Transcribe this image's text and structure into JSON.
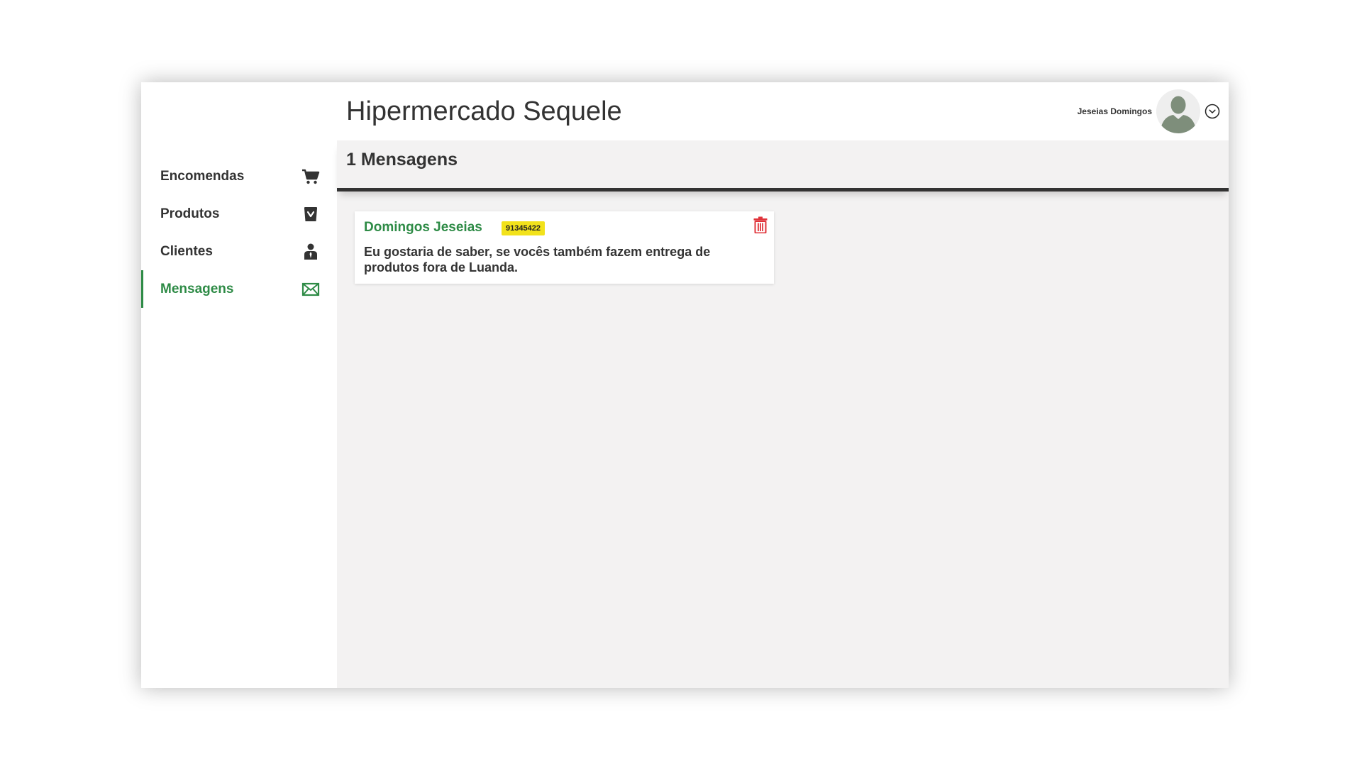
{
  "header": {
    "title": "Hipermercado Sequele",
    "user_name": "Jeseias Domingos"
  },
  "sidebar": {
    "items": [
      {
        "label": "Encomendas",
        "icon": "shopping-cart-icon"
      },
      {
        "label": "Produtos",
        "icon": "shopping-bag-icon"
      },
      {
        "label": "Clientes",
        "icon": "user-tie-icon"
      },
      {
        "label": "Mensagens",
        "icon": "envelope-icon",
        "active": true
      }
    ]
  },
  "main": {
    "section_title": "1 Mensagens",
    "messages": [
      {
        "sender": "Domingos Jeseias",
        "phone": "91345422",
        "text": "Eu gostaria de saber, se vocês também fazem entrega de produtos fora de Luanda."
      }
    ]
  },
  "colors": {
    "accent": "#2e8b46",
    "badge": "#f2e21b",
    "delete": "#e0343b",
    "text": "#333333",
    "content_bg": "#f3f2f2"
  }
}
